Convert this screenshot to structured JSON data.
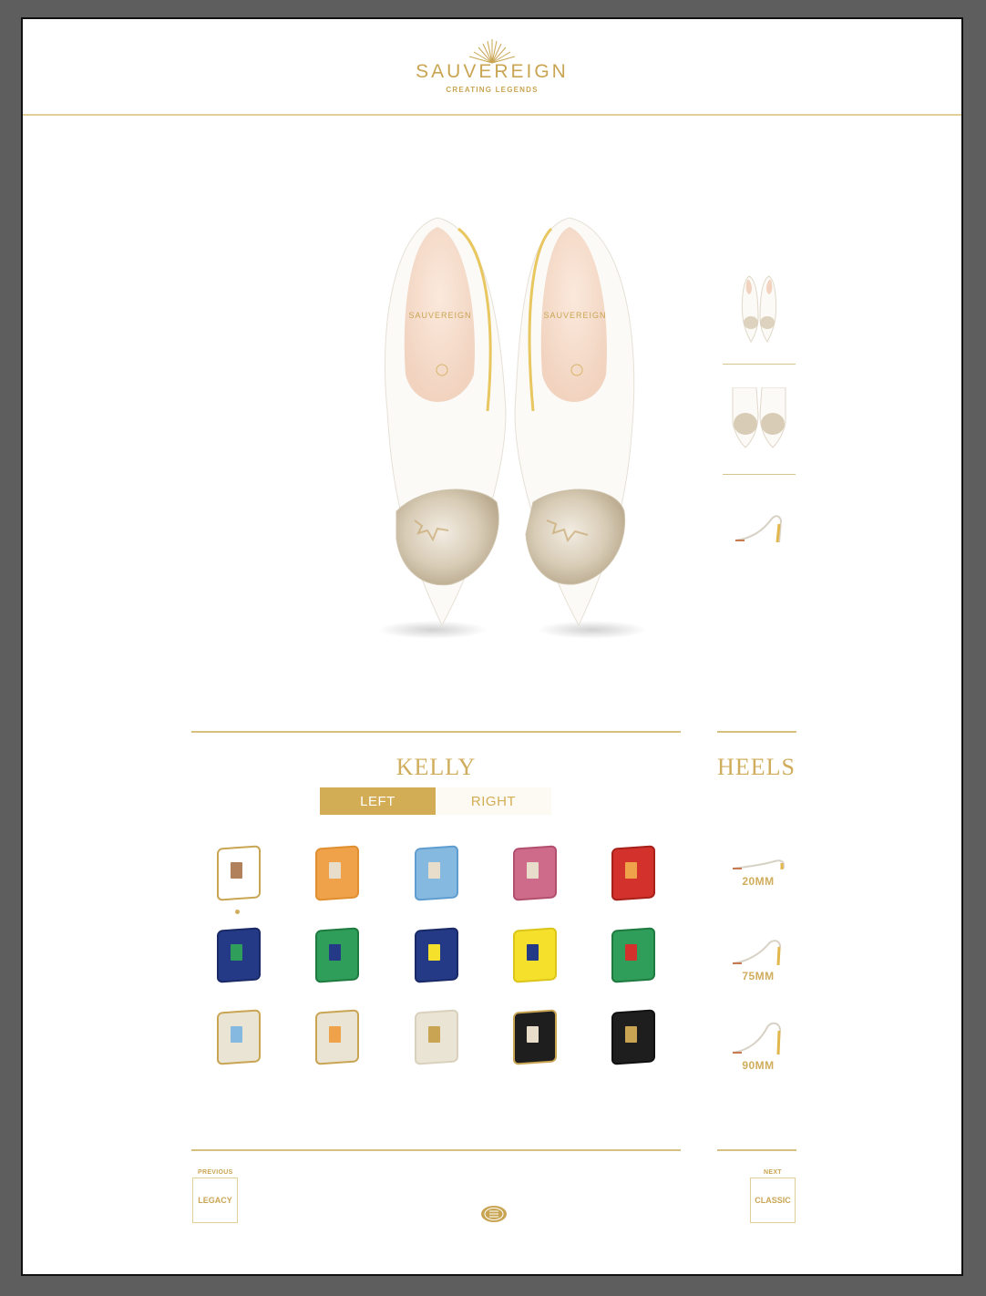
{
  "header": {
    "brand": "SAUVEREIGN",
    "tagline": "CREATING LEGENDS"
  },
  "hero": {
    "image": "shoe-pair-top-view",
    "insole_text": "SAUVEREIGN"
  },
  "thumbnails": [
    {
      "name": "pair-top-view"
    },
    {
      "name": "toe-closeup"
    },
    {
      "name": "side-profile"
    }
  ],
  "model": {
    "title": "KELLY"
  },
  "heels": {
    "title": "HEELS"
  },
  "side_toggle": {
    "left": "LEFT",
    "right": "RIGHT",
    "selected": "LEFT"
  },
  "swatches": [
    [
      {
        "outer": "#ffffff",
        "border": "#c9a553",
        "inner": "#b0815a",
        "selected": true
      },
      {
        "outer": "#f0a24a",
        "border": "#e08f30",
        "inner": "#e8dccb"
      },
      {
        "outer": "#86b9e0",
        "border": "#5f9dd0",
        "inner": "#e8dccb"
      },
      {
        "outer": "#cf6b8a",
        "border": "#b34f6e",
        "inner": "#e8dccb"
      },
      {
        "outer": "#d2322b",
        "border": "#a8201a",
        "inner": "#f0a24a"
      }
    ],
    [
      {
        "outer": "#253a86",
        "border": "#1a2a66",
        "inner": "#2f9e5a"
      },
      {
        "outer": "#2f9e5a",
        "border": "#1f7a40",
        "inner": "#253a86"
      },
      {
        "outer": "#253a86",
        "border": "#1a2a66",
        "inner": "#f5e02c"
      },
      {
        "outer": "#f5e02c",
        "border": "#dcc51a",
        "inner": "#253a86"
      },
      {
        "outer": "#2f9e5a",
        "border": "#1f7a40",
        "inner": "#d2322b"
      }
    ],
    [
      {
        "outer": "#eae4d4",
        "border": "#c9a553",
        "inner": "#86b9e0"
      },
      {
        "outer": "#eae4d4",
        "border": "#c9a553",
        "inner": "#f0a24a"
      },
      {
        "outer": "#eae4d4",
        "border": "#d9d1bd",
        "inner": "#c9a553"
      },
      {
        "outer": "#1e1e1e",
        "border": "#c9a553",
        "inner": "#e8dccb"
      },
      {
        "outer": "#1e1e1e",
        "border": "#111111",
        "inner": "#c9a553"
      }
    ]
  ],
  "heel_options": [
    {
      "label": "20MM",
      "height_mm": 20
    },
    {
      "label": "75MM",
      "height_mm": 75
    },
    {
      "label": "90MM",
      "height_mm": 90
    }
  ],
  "navigation": {
    "previous_caption": "PREVIOUS",
    "previous_label": "LEGACY",
    "next_caption": "NEXT",
    "next_label": "CLASSIC"
  },
  "colors": {
    "gold": "#c9a553",
    "toggle_active": "#d3ad55",
    "frame": "#5e5e5e"
  }
}
